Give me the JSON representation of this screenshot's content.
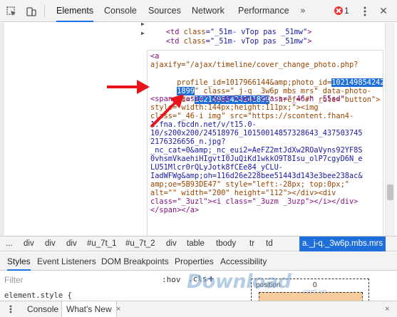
{
  "toolbar": {
    "tabs": [
      "Elements",
      "Console",
      "Sources",
      "Network",
      "Performance"
    ],
    "active_tab": "Elements",
    "error_count": "1",
    "accent_color": "#1a73e8",
    "error_color": "#e53935",
    "icons": [
      "inspect-element-icon",
      "device-toolbar-icon",
      "more-tabs-icon",
      "error-icon",
      "kebab-menu-icon",
      "close-icon"
    ]
  },
  "elements": {
    "lines_above": [
      {
        "t1": "<",
        "tag": "td",
        "a1": " class",
        "v1": "=\"_51m- vTop pas _51mw\"",
        "t2": ">"
      },
      {
        "t1": "<",
        "tag": "td",
        "a1": " class",
        "v1": "=\"_51m- vTop pas _51mw\"",
        "t2": ">"
      }
    ],
    "block": {
      "l1": "<a",
      "l2": "ajaxify=\"/ajax/timeline/cover_change_photo.php?",
      "l3a": "profile_id=1017966144&amp;photo_id=",
      "l3b": "1021498542424",
      "l4a": "1899",
      "l4b": "\" class=\"_j-q _3w6p mbs mrs\" data-photo-",
      "l5a": "id=\"",
      "l5b": "10214985424241899",
      "l5c": "\" href=\"#\" role=\"button\">",
      "l6": "<span class=\"_5ig0\"><div class=\"_46-h _55sd\"",
      "l7": "style=\"width:144px;height:111px;\"><img",
      "l8": "class=\"_46-i img\" src=\"https://scontent.fhan4-",
      "l9": "1.fna.fbcdn.net/v/t15.0-",
      "l10": "10/s200x200/24518976_10150014857328643_437503745",
      "l11": "2176326656_n.jpg?",
      "l12": "_nc_cat=0&amp;_nc_eui2=AeFZ2mtJdXw2ROaVyns92YF8S",
      "l13": "0vhsmVkaehiHIgvtI0JuQiKd1wkkO9T8Isu_olP7cgyD6N_e",
      "l14": "LU51Mlcr0rQLyJotk8fCEe84_yCLU-",
      "l15": "IadWFWg&amp;oh=116d26e228bee51443d143e3bee238ac&",
      "l16": "amp;oe=5B93DE47\" style=\"left:-28px; top:0px;\"",
      "l17": "alt=\"\" width=\"200\" height=\"112\"></div><div",
      "l18": "class=\"_3uzl\"><i class=\"_3uzm _3uzp\"></i></div>",
      "l19": "</span></a>"
    },
    "highlight_color": "#1e6fd9"
  },
  "breadcrumbs": {
    "items": [
      "...",
      "div",
      "div",
      "div",
      "#u_7t_1",
      "#u_7t_2",
      "div",
      "table",
      "tbody",
      "tr",
      "td",
      "a._j-q._3w6p.mbs.mrs"
    ],
    "active": "a._j-q._3w6p.mbs.mrs"
  },
  "subtabs": {
    "items": [
      "Styles",
      "Event Listeners",
      "DOM Breakpoints",
      "Properties",
      "Accessibility"
    ],
    "active": "Styles"
  },
  "styles_pane": {
    "filter_placeholder": "Filter",
    "hov": ":hov",
    "cls": ".cls",
    "add": "+",
    "element_style": "element.style {",
    "box_position_label": "position",
    "box_position_value": "0",
    "margin_color": "#f9cc9d"
  },
  "drawer": {
    "items": [
      "Console",
      "What's New"
    ],
    "active": "What's New",
    "close": "×"
  },
  "watermark": {
    "text": "Download",
    "sub": ".com.vn"
  },
  "annotation": {
    "arrow_color": "#e8141c"
  }
}
